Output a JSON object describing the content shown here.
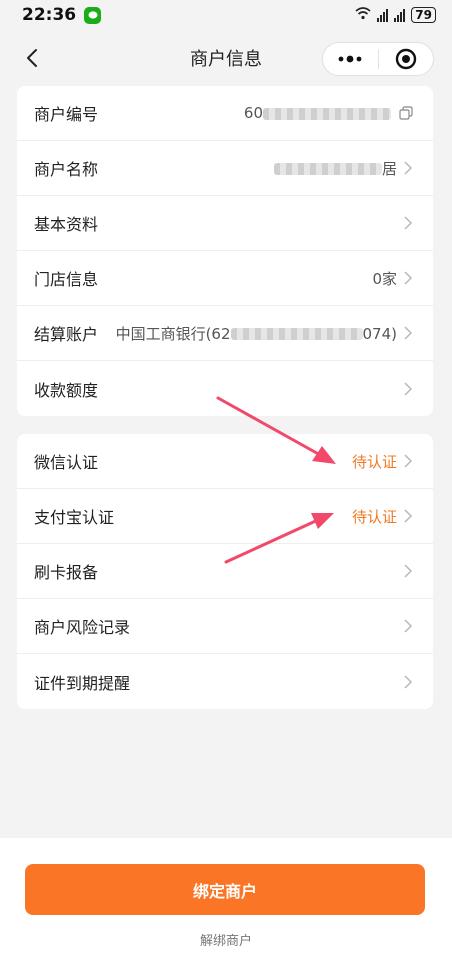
{
  "status_bar": {
    "time": "22:36",
    "battery": "79"
  },
  "navbar": {
    "title": "商户信息"
  },
  "group1": [
    {
      "label": "商户编号",
      "value_prefix": "60",
      "value_suffix": "",
      "copyable": true,
      "chevron": false
    },
    {
      "label": "商户名称",
      "value_prefix": "",
      "value_suffix": "居",
      "copyable": false,
      "chevron": true
    },
    {
      "label": "基本资料",
      "value_prefix": "",
      "value_suffix": "",
      "copyable": false,
      "chevron": true
    },
    {
      "label": "门店信息",
      "value_prefix": "",
      "value_suffix": "0家",
      "copyable": false,
      "chevron": true
    },
    {
      "label": "结算账户",
      "value_prefix": "中国工商银行(62",
      "value_suffix": "074)",
      "copyable": false,
      "chevron": true
    },
    {
      "label": "收款额度",
      "value_prefix": "",
      "value_suffix": "",
      "copyable": false,
      "chevron": true
    }
  ],
  "group2": [
    {
      "label": "微信认证",
      "value": "待认证"
    },
    {
      "label": "支付宝认证",
      "value": "待认证"
    },
    {
      "label": "刷卡报备",
      "value": ""
    },
    {
      "label": "商户风险记录",
      "value": ""
    },
    {
      "label": "证件到期提醒",
      "value": ""
    }
  ],
  "bind_button": "绑定商户",
  "unbind_link": "解绑商户",
  "colors": {
    "accent": "#fb7526",
    "status_orange": "#f07a22",
    "arrow": "#f2486a"
  }
}
